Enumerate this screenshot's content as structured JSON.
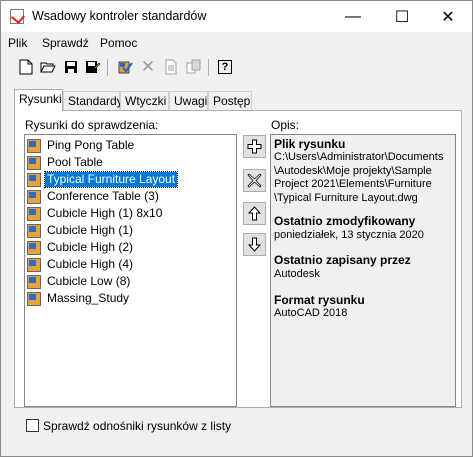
{
  "window": {
    "title": "Wsadowy kontroler standardów",
    "minimize_glyph": "—",
    "maximize_glyph": "☐",
    "close_glyph": "✕"
  },
  "menu": [
    "Plik",
    "Sprawdź",
    "Pomoc"
  ],
  "toolbar": {
    "icons": [
      "new-icon",
      "open-icon",
      "save-icon",
      "save-as-icon",
      "check-icon",
      "delete-icon",
      "copy-icon",
      "report-icon",
      "help-icon"
    ],
    "help_label": "?"
  },
  "tabs": [
    "Rysunki",
    "Standardy",
    "Wtyczki",
    "Uwagi",
    "Postęp"
  ],
  "drawings": {
    "label": "Rysunki do sprawdzenia:",
    "items": [
      "Ping Pong Table",
      "Pool Table",
      "Typical Furniture Layout",
      "Conference Table (3)",
      "Cubicle High (1) 8x10",
      "Cubicle High (1)",
      "Cubicle High (2)",
      "Cubicle High (4)",
      "Cubicle Low (8)",
      "Massing_Study"
    ],
    "selected_index": 2
  },
  "side_buttons": [
    "plus-icon",
    "cross-icon",
    "up-arrow-icon",
    "down-arrow-icon"
  ],
  "description": {
    "label": "Opis:",
    "file_heading": "Plik rysunku",
    "file_path": "C:\\Users\\Administrator\\Documents\n\\Autodesk\\Moje projekty\\Sample\nProject 2021\\Elements\\Furniture\n\\Typical Furniture Layout.dwg",
    "modified_heading": "Ostatnio zmodyfikowany",
    "modified_value": "poniedziałek, 13 stycznia 2020",
    "saved_by_heading": "Ostatnio zapisany przez",
    "saved_by_value": "Autodesk",
    "format_heading": "Format rysunku",
    "format_value": "AutoCAD 2018"
  },
  "checkbox": {
    "label": "Sprawdź odnośniki rysunków z listy",
    "checked": false
  }
}
